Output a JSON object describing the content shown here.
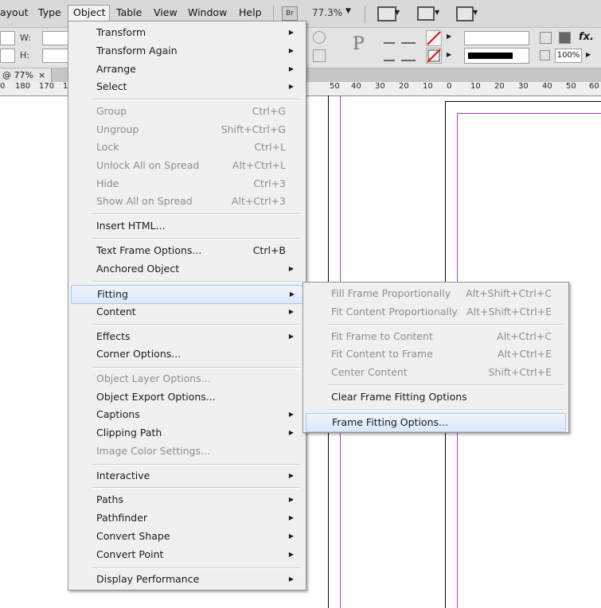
{
  "menubar": {
    "items": [
      "ayout",
      "Type",
      "Object",
      "Table",
      "View",
      "Window",
      "Help"
    ],
    "active": "Object",
    "bridge_label": "Br",
    "zoom": "77.3%"
  },
  "control_panel": {
    "w_label": "W:",
    "h_label": "H:",
    "scale_value": "100%"
  },
  "document_tab": {
    "label": "@ 77%",
    "close": "×"
  },
  "ruler": {
    "ticks": [
      "0",
      "180",
      "170",
      "1",
      "50",
      "40",
      "30",
      "20",
      "10",
      "0",
      "10",
      "20",
      "30",
      "40",
      "50",
      "60"
    ]
  },
  "object_menu": {
    "items": [
      {
        "label": "Transform",
        "shortcut": "",
        "submenu": true,
        "enabled": true
      },
      {
        "label": "Transform Again",
        "shortcut": "",
        "submenu": true,
        "enabled": true
      },
      {
        "label": "Arrange",
        "shortcut": "",
        "submenu": true,
        "enabled": true
      },
      {
        "label": "Select",
        "shortcut": "",
        "submenu": true,
        "enabled": true
      },
      {
        "label": "Group",
        "shortcut": "Ctrl+G",
        "submenu": false,
        "enabled": false
      },
      {
        "label": "Ungroup",
        "shortcut": "Shift+Ctrl+G",
        "submenu": false,
        "enabled": false
      },
      {
        "label": "Lock",
        "shortcut": "Ctrl+L",
        "submenu": false,
        "enabled": false
      },
      {
        "label": "Unlock All on Spread",
        "shortcut": "Alt+Ctrl+L",
        "submenu": false,
        "enabled": false
      },
      {
        "label": "Hide",
        "shortcut": "Ctrl+3",
        "submenu": false,
        "enabled": false
      },
      {
        "label": "Show All on Spread",
        "shortcut": "Alt+Ctrl+3",
        "submenu": false,
        "enabled": false
      },
      {
        "label": "Insert HTML...",
        "shortcut": "",
        "submenu": false,
        "enabled": true
      },
      {
        "label": "Text Frame Options...",
        "shortcut": "Ctrl+B",
        "submenu": false,
        "enabled": true
      },
      {
        "label": "Anchored Object",
        "shortcut": "",
        "submenu": true,
        "enabled": true
      },
      {
        "label": "Fitting",
        "shortcut": "",
        "submenu": true,
        "enabled": true
      },
      {
        "label": "Content",
        "shortcut": "",
        "submenu": true,
        "enabled": true
      },
      {
        "label": "Effects",
        "shortcut": "",
        "submenu": true,
        "enabled": true
      },
      {
        "label": "Corner Options...",
        "shortcut": "",
        "submenu": false,
        "enabled": true
      },
      {
        "label": "Object Layer Options...",
        "shortcut": "",
        "submenu": false,
        "enabled": false
      },
      {
        "label": "Object Export Options...",
        "shortcut": "",
        "submenu": false,
        "enabled": true
      },
      {
        "label": "Captions",
        "shortcut": "",
        "submenu": true,
        "enabled": true
      },
      {
        "label": "Clipping Path",
        "shortcut": "",
        "submenu": true,
        "enabled": true
      },
      {
        "label": "Image Color Settings...",
        "shortcut": "",
        "submenu": false,
        "enabled": false
      },
      {
        "label": "Interactive",
        "shortcut": "",
        "submenu": true,
        "enabled": true
      },
      {
        "label": "Paths",
        "shortcut": "",
        "submenu": true,
        "enabled": true
      },
      {
        "label": "Pathfinder",
        "shortcut": "",
        "submenu": true,
        "enabled": true
      },
      {
        "label": "Convert Shape",
        "shortcut": "",
        "submenu": true,
        "enabled": true
      },
      {
        "label": "Convert Point",
        "shortcut": "",
        "submenu": true,
        "enabled": true
      },
      {
        "label": "Display Performance",
        "shortcut": "",
        "submenu": true,
        "enabled": true
      }
    ]
  },
  "fitting_submenu": {
    "items": [
      {
        "label": "Fill Frame Proportionally",
        "shortcut": "Alt+Shift+Ctrl+C",
        "enabled": false
      },
      {
        "label": "Fit Content Proportionally",
        "shortcut": "Alt+Shift+Ctrl+E",
        "enabled": false
      },
      {
        "label": "Fit Frame to Content",
        "shortcut": "Alt+Ctrl+C",
        "enabled": false
      },
      {
        "label": "Fit Content to Frame",
        "shortcut": "Alt+Ctrl+E",
        "enabled": false
      },
      {
        "label": "Center Content",
        "shortcut": "Shift+Ctrl+E",
        "enabled": false
      },
      {
        "label": "Clear Frame Fitting Options",
        "shortcut": "",
        "enabled": true
      },
      {
        "label": "Frame Fitting Options...",
        "shortcut": "",
        "enabled": true
      }
    ]
  },
  "colors": {
    "guide": "#b53ad1",
    "menu_bg": "#f0f0f0",
    "highlight": "#dce9f8"
  }
}
